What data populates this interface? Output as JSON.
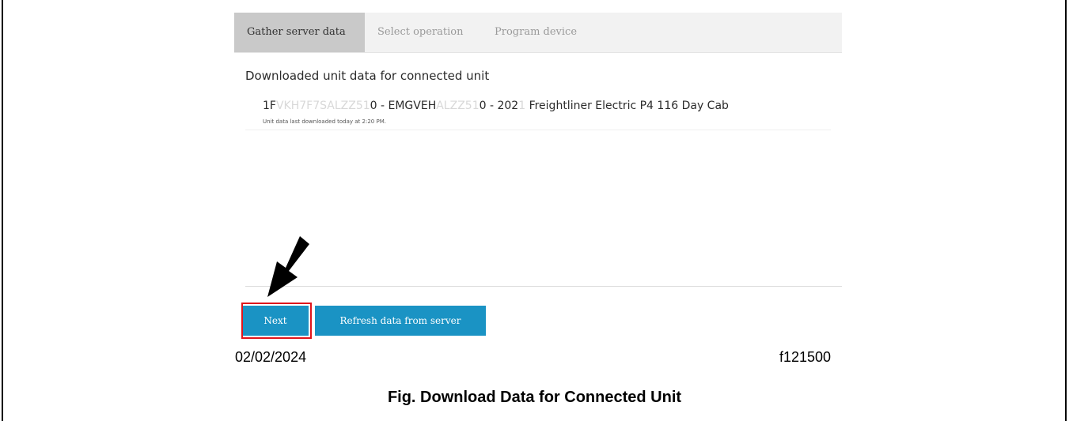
{
  "tabs": [
    {
      "label": "Gather server data",
      "active": true
    },
    {
      "label": "Select operation",
      "active": false
    },
    {
      "label": "Program device",
      "active": false
    }
  ],
  "content": {
    "heading": "Downloaded unit data for connected unit",
    "unit": {
      "prefix": "1F",
      "redacted1": "VKH7F7SALZZ51",
      "mid": "0 - EMGVEH",
      "redacted2": "ALZZ51",
      "after": "0 - 202",
      "redacted3": "1",
      "tail": " Freightliner Electric P4 116 Day Cab"
    },
    "last_downloaded": "Unit data last downloaded today at 2:20 PM."
  },
  "buttons": {
    "next": "Next",
    "refresh": "Refresh data from server"
  },
  "footer": {
    "date": "02/02/2024",
    "figure_id": "f121500",
    "caption": "Fig. Download Data for Connected Unit"
  },
  "colors": {
    "button": "#1a93c4",
    "highlight": "#e0141b",
    "active_tab": "#c9c9c9",
    "tabbar": "#f2f2f2"
  }
}
